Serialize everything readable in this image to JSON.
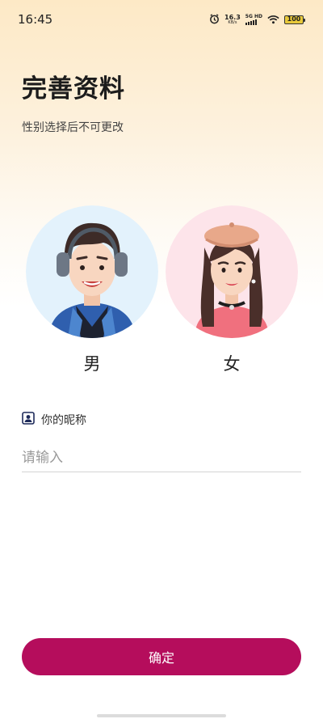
{
  "status_bar": {
    "time": "16:45",
    "net_speed_value": "16.3",
    "net_speed_unit": "KB/s",
    "signal_label": "5G HD",
    "battery": "100",
    "icons": [
      "alarm-icon",
      "signal-icon",
      "wifi-icon",
      "battery-icon"
    ]
  },
  "header": {
    "title": "完善资料",
    "subtitle": "性别选择后不可更改"
  },
  "gender": {
    "male_label": "男",
    "female_label": "女"
  },
  "nickname": {
    "label": "你的昵称",
    "placeholder": "请输入",
    "value": ""
  },
  "confirm_label": "确定",
  "colors": {
    "accent": "#b50d5c",
    "male_bg": "#e3f2fc",
    "female_bg": "#fde4ea"
  }
}
